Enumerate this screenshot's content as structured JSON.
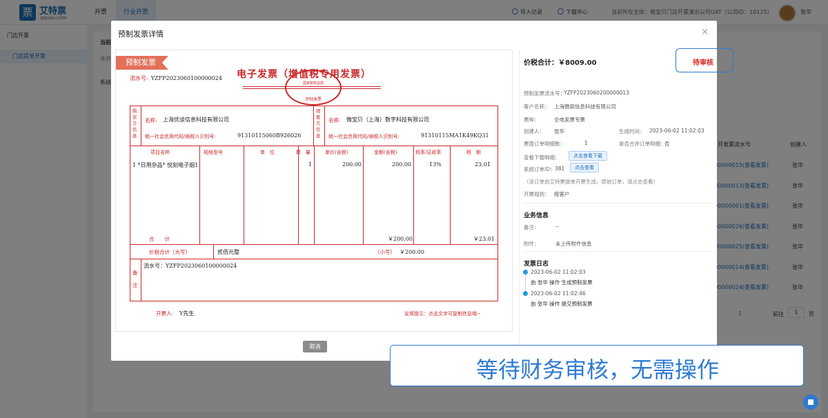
{
  "app": {
    "logo_char": "票",
    "logo_name": "艾特票",
    "logo_url_text": "atpiao.com",
    "nav": [
      "开票",
      "行业开票"
    ],
    "import_records": "导入记录",
    "download_center": "下载中心",
    "current_entity": "当前所在主体：微宝贝门店开票演示公司UAT（公司ID：10125）",
    "user": "张华"
  },
  "sidebar": {
    "section": "门店开票",
    "item": "门店提单开票"
  },
  "background": {
    "label_current": "当前",
    "label_not": "未开",
    "label_system": "系统",
    "column_serial": "开发票流水号",
    "column_creator": "创建人",
    "rows": [
      {
        "serial": "200000015(查看发票)",
        "creator": "张华"
      },
      {
        "serial": "200000013(查看发票)",
        "creator": "张华"
      },
      {
        "serial": "200000001(查看发票)",
        "creator": "张华"
      },
      {
        "serial": "100000026(查看发票)",
        "creator": "张华"
      },
      {
        "serial": "100000025(查看发票)",
        "creator": "张华"
      },
      {
        "serial": "100000014(查看发票)",
        "creator": "张华"
      },
      {
        "serial": "100000024(查看发票)",
        "creator": "张华"
      }
    ],
    "pager_current": "1",
    "pager_goto": "前往",
    "pager_page": "1",
    "pager_unit": "页"
  },
  "modal": {
    "title": "预制发票详情",
    "close": "×",
    "cancel": "取消"
  },
  "invoice": {
    "tag": "预制发票",
    "serial_label": "流水号:",
    "serial": "YZFP2023060100000024",
    "title": "电子发票（增值税专用发票）",
    "seal_top": "国家税务总局",
    "seal_bottom": "评制发票",
    "buyer_side": "购买方信息",
    "seller_side": "销售方信息",
    "name_label": "名称:",
    "buyer_name": "上海优谈信息科技有限公司",
    "seller_name": "微宝贝（上海）数字科技有限公司",
    "tax_id_label": "统一社会信用代码/纳税人识别号:",
    "buyer_tax_id": "91310115060B926026",
    "seller_tax_id": "91310115MA1K49KQ31",
    "col_item": "项目名称",
    "col_spec": "规格型号",
    "col_unit": "单　位",
    "col_qty": "数　量",
    "col_price": "单价(含税)",
    "col_amount": "金额(含税)",
    "col_rate": "税率/征收率",
    "col_tax": "税　额",
    "item_name": "1 *日用杂品* 悦刻电子烟1",
    "item_qty": "1",
    "item_price": "200.00",
    "item_amount": "200.00",
    "item_rate": "13%",
    "item_tax": "23.01",
    "subtotal_label": "合　　计",
    "subtotal_amount": "￥200.00",
    "subtotal_tax": "￥23.01",
    "total_label": "价税合计（大写）",
    "total_upper": "贰佰元整",
    "total_small_label": "（小写）",
    "total_small": "￥200.00",
    "remark_side": "备注",
    "remark": "流水号：YZFP2023060100000024",
    "issuer_label": "开票人:",
    "issuer": "Y先生",
    "tip": "友情提示：点击文字可复制信息哦~"
  },
  "detail": {
    "total_label": "价税合计：",
    "total_value": "￥8009.00",
    "status": "待审核",
    "fields": [
      {
        "k": "预制发票流水号：",
        "v": "YZFP2023060200000013"
      },
      {
        "k": "客户名称：",
        "v": "上海微丽信息科技有限公司"
      },
      {
        "k": "票种：",
        "v": "全电发票专票"
      },
      {
        "k": "创建人：",
        "v": "张华"
      },
      {
        "k": "票面订单明细数：",
        "v": "1"
      },
      {
        "k": "查看下载明细：",
        "v": ""
      },
      {
        "k": "系统订单ID：",
        "v": "381"
      }
    ],
    "created_time_label": "生成时间：",
    "created_time": "2023-06-02 11:02:03",
    "merge_label": "是否合并订单明细：",
    "merge_value": "否",
    "view_download_btn": "点击查看下载",
    "view_btn": "点击查看",
    "note": "（该订单由艾特票提单开票生成，原始订单，请点击查看）",
    "rule_label": "开票规则：",
    "rule_value": "按客户",
    "biz_title": "业务信息",
    "remark_label": "备注：",
    "remark_value": "--",
    "attach_label": "附件：",
    "attach_value": "未上传附件信息",
    "log_title": "发票日志",
    "logs": [
      {
        "time": "2023-06-02 11:02:03",
        "text": "由 张华 操作 生成预制发票"
      },
      {
        "time": "2023-06-02 11:02:46",
        "text": "由 张华 操作 提交预制发票"
      }
    ]
  },
  "banner": {
    "text": "等待财务审核，无需操作"
  },
  "colors": {
    "accent": "#2e7ad1",
    "invoice_red": "#c8282a",
    "status_red": "#d9251c",
    "tag": "#e2715a"
  }
}
